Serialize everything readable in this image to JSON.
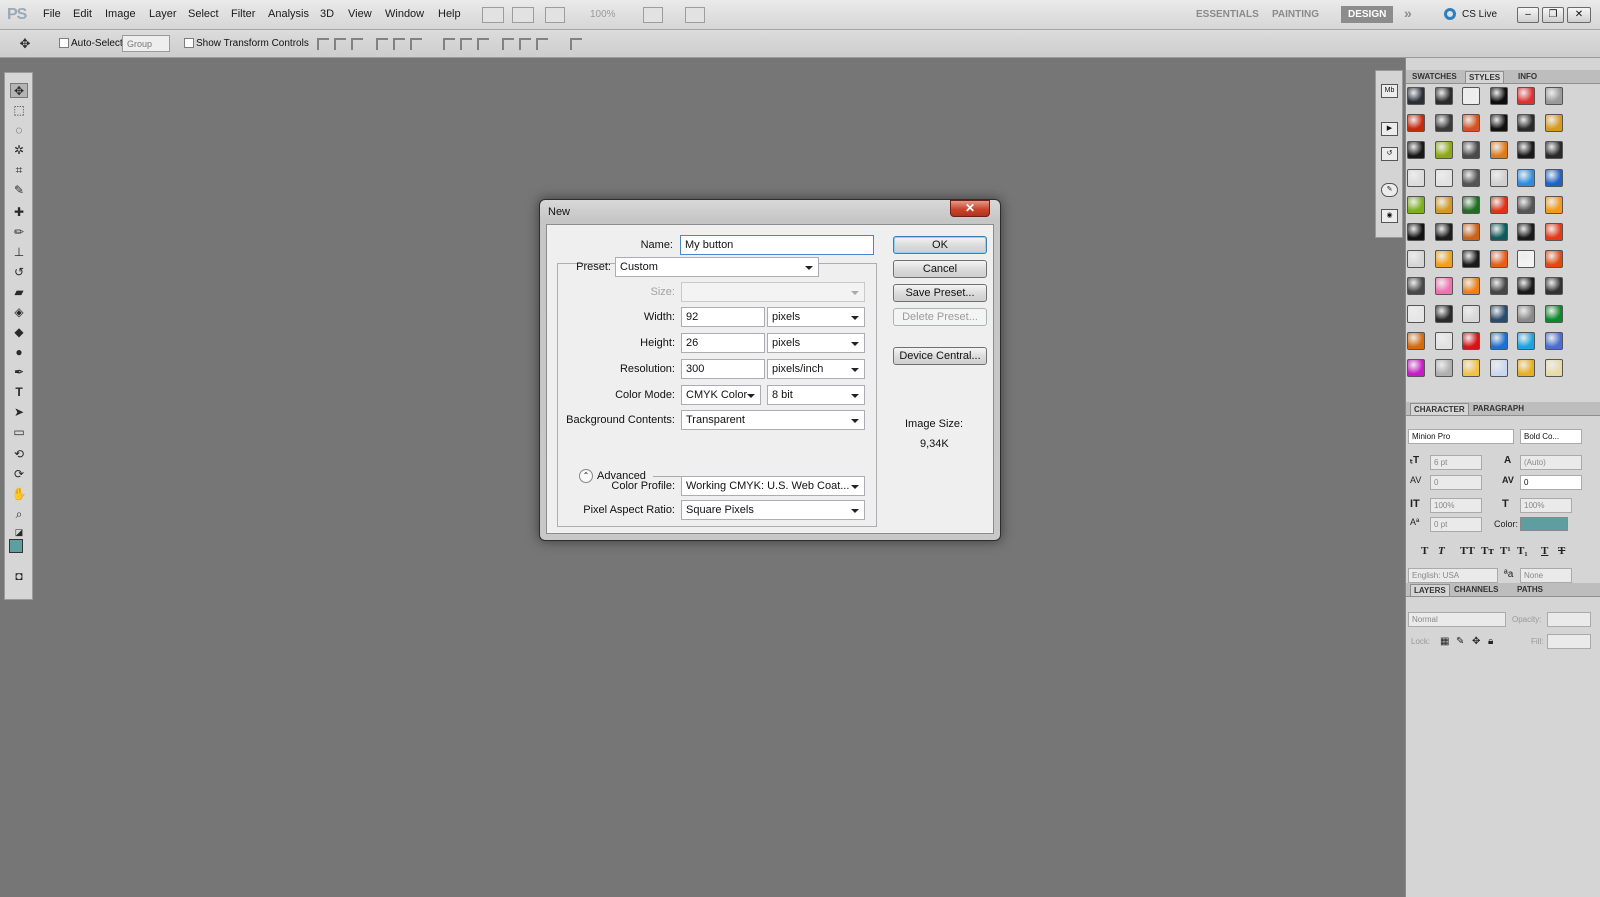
{
  "app": {
    "logo": "PS"
  },
  "menu": [
    "File",
    "Edit",
    "Image",
    "Layer",
    "Select",
    "Filter",
    "Analysis",
    "3D",
    "View",
    "Window",
    "Help"
  ],
  "menubar_zoom": "100%",
  "workspaces": {
    "essentials": "ESSENTIALS",
    "painting": "PAINTING",
    "design": "DESIGN",
    "more": "»",
    "cslive": "CS Live"
  },
  "options": {
    "auto_select_label": "Auto-Select:",
    "auto_select_value": "Group",
    "transform_label": "Show Transform Controls"
  },
  "panels": {
    "top_tabs": [
      "SWATCHES",
      "STYLES",
      "INFO"
    ],
    "char_tabs": [
      "CHARACTER",
      "PARAGRAPH"
    ],
    "layer_tabs": [
      "LAYERS",
      "CHANNELS",
      "PATHS"
    ],
    "character": {
      "font_family": "Minion Pro",
      "font_style": "Bold Co...",
      "size": "6 pt",
      "leading": "(Auto)",
      "kerning": "0",
      "tracking": "0",
      "vscale": "100%",
      "hscale": "100%",
      "baseline": "0 pt",
      "color_label": "Color:",
      "color": "#5f9ea0",
      "language": "English: USA",
      "antialias": "None",
      "aa_glyph": "ªa"
    },
    "layers": {
      "blend": "Normal",
      "opacity_label": "Opacity:",
      "lock_label": "Lock:",
      "fill_label": "Fill:"
    }
  },
  "styles_colors": [
    [
      "#2a2f3a",
      "#2b2b2b",
      "#eeeeee",
      "#0d0d0d",
      "#e03131",
      "#9a9a9a"
    ],
    [
      "#c8280e",
      "#3a3a3a",
      "#d2531f",
      "#111111",
      "#2a2a2a",
      "#d79a1f"
    ],
    [
      "#181818",
      "#8caa10",
      "#4a4a4a",
      "#e07a18",
      "#1a1a1a",
      "#2a2a2a"
    ],
    [
      "#dcdcdc",
      "#e2e2e2",
      "#555555",
      "#d0d0d0",
      "#2c8ee0",
      "#1f62c8"
    ],
    [
      "#7ab018",
      "#d09a20",
      "#1f6e24",
      "#e0321a",
      "#555555",
      "#f39a1a"
    ],
    [
      "#121212",
      "#1c1c1c",
      "#c8621c",
      "#0f5a5a",
      "#1a1a1a",
      "#e43a1a"
    ],
    [
      "#d6d6d6",
      "#f2a018",
      "#1a1a1a",
      "#e95d18",
      "#f3f3f3",
      "#e04a0c"
    ],
    [
      "#484848",
      "#f070b0",
      "#e8821a",
      "#464646",
      "#1a1a1a",
      "#333333"
    ],
    [
      "#e6e6e6",
      "#2a2a2a",
      "#d8d8d8",
      "#2c4a6c",
      "#8a8a8a",
      "#0a8a2c"
    ],
    [
      "#d46a0a",
      "#e2e2e2",
      "#d61414",
      "#1f6fd0",
      "#18a4e0",
      "#4a6ed0"
    ],
    [
      "#c81ac8",
      "#b0b0b0",
      "#f2c248",
      "#c8d8f0",
      "#e8b020",
      "#e6dca8"
    ]
  ],
  "dialog": {
    "title": "New",
    "close": "✕",
    "name_label": "Name:",
    "name_value": "My button",
    "preset_label": "Preset:",
    "preset_value": "Custom",
    "size_label": "Size:",
    "width_label": "Width:",
    "width_value": "92",
    "width_unit": "pixels",
    "height_label": "Height:",
    "height_value": "26",
    "height_unit": "pixels",
    "resolution_label": "Resolution:",
    "resolution_value": "300",
    "resolution_unit": "pixels/inch",
    "color_mode_label": "Color Mode:",
    "color_mode_value": "CMYK Color",
    "bit_depth": "8 bit",
    "bg_label": "Background Contents:",
    "bg_value": "Transparent",
    "advanced_label": "Advanced",
    "profile_label": "Color Profile:",
    "profile_value": "Working CMYK:  U.S. Web Coat...",
    "par_label": "Pixel Aspect Ratio:",
    "par_value": "Square Pixels",
    "ok": "OK",
    "cancel": "Cancel",
    "save_preset": "Save Preset...",
    "delete_preset": "Delete Preset...",
    "device_central": "Device Central...",
    "image_size_label": "Image Size:",
    "image_size_value": "9,34K"
  }
}
